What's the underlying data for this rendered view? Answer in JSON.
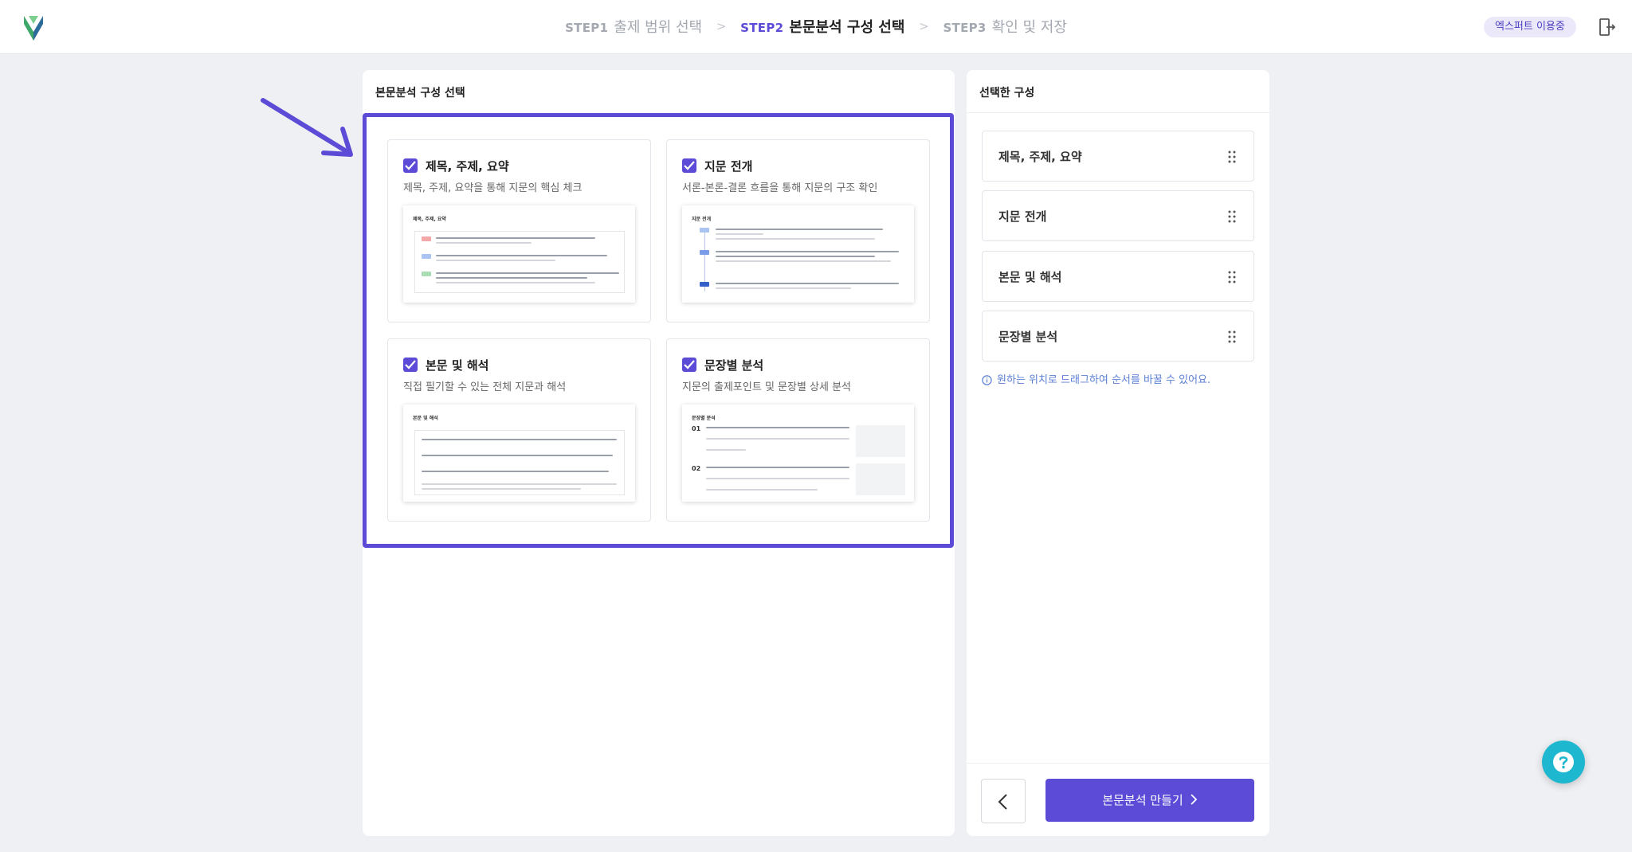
{
  "header": {
    "steps": [
      {
        "num": "STEP1",
        "label": "출제 범위 선택"
      },
      {
        "num": "STEP2",
        "label": "본문분석 구성 선택"
      },
      {
        "num": "STEP3",
        "label": "확인 및 저장"
      }
    ],
    "active_step": 2,
    "badge": "엑스퍼트 이용중"
  },
  "left_panel": {
    "title": "본문분석 구성 선택",
    "cards": [
      {
        "title": "제목, 주제, 요약",
        "desc": "제목, 주제, 요약을 통해 지문의 핵심 체크",
        "checked": true,
        "preview_title": "제목, 주제, 요약"
      },
      {
        "title": "지문 전개",
        "desc": "서론-본론-결론 흐름을 통해 지문의 구조 확인",
        "checked": true,
        "preview_title": "지문 전개"
      },
      {
        "title": "본문 및 해석",
        "desc": "직접 필기할 수 있는 전체 지문과 해석",
        "checked": true,
        "preview_title": "본문 및 해석"
      },
      {
        "title": "문장별 분석",
        "desc": "지문의 출제포인트 및 문장별 상세 분석",
        "checked": true,
        "preview_title": "문장별 분석"
      }
    ]
  },
  "right_panel": {
    "title": "선택한 구성",
    "items": [
      "제목, 주제, 요약",
      "지문 전개",
      "본문 및 해석",
      "문장별 분석"
    ],
    "hint": "원하는 위치로 드래그하여 순서를 바꿀 수 있어요.",
    "create_label": "본문분석 만들기"
  },
  "colors": {
    "accent": "#5b4bd6",
    "help": "#1db7cf"
  },
  "icons": [
    "logo-icon",
    "logout-icon",
    "check-icon",
    "drag-handle-icon",
    "info-icon",
    "chevron-left-icon",
    "chevron-right-icon",
    "help-icon",
    "arrow-icon"
  ]
}
